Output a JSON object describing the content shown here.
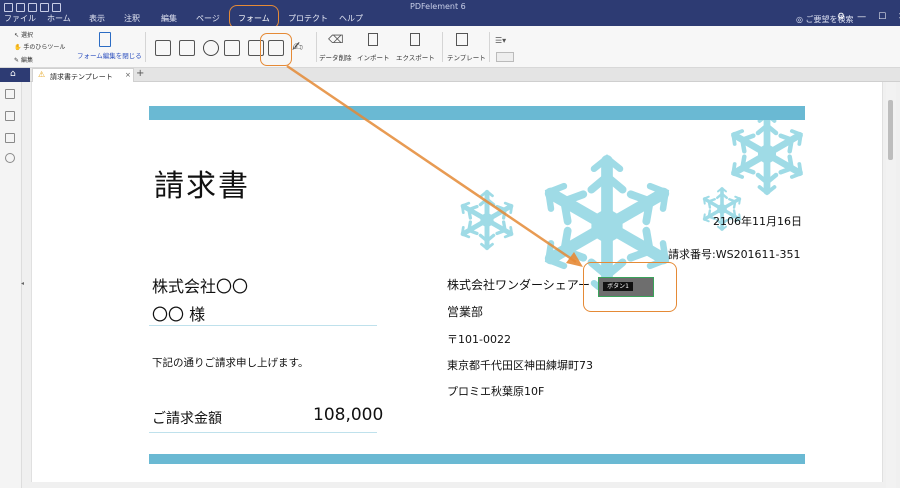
{
  "app": {
    "title": "PDFelement 6"
  },
  "menu": {
    "items": [
      "ファイル",
      "ホーム",
      "表示",
      "注釈",
      "編集",
      "ページ",
      "フォーム",
      "プロテクト",
      "ヘルプ"
    ],
    "active": "フォーム",
    "help_search": "ご要望を検索"
  },
  "ribbon": {
    "tools": {
      "select": "選択",
      "hand": "手のひらツール",
      "edit": "編集"
    },
    "close_form_edit": "フォーム編集を閉じる",
    "data_delete": "データ削除",
    "import": "インポート",
    "export": "エクスポート",
    "template": "テンプレート"
  },
  "tabs": {
    "document": "請求書テンプレート",
    "add": "+"
  },
  "document": {
    "title": "請求書",
    "date": "2106年11月16日",
    "invoice_no": "請求番号:WS201611-351",
    "recipient_company": "株式会社〇〇",
    "recipient_name": "〇〇 様",
    "message": "下記の通りご請求申し上げます。",
    "amount_label": "ご請求金額",
    "amount_value": "108,000",
    "sender_company": "株式会社ワンダーシェアー",
    "sender_dept": "営業部",
    "postal": "〒101-0022",
    "address1": "東京都千代田区神田練塀町73",
    "address2": "プロミエ秋葉原10F"
  },
  "form_button": {
    "label": "ボタン1"
  },
  "colors": {
    "titlebar": "#2d3b73",
    "band": "#6ab9d3",
    "snow": "#9fdbe6",
    "highlight": "#e58a36"
  }
}
